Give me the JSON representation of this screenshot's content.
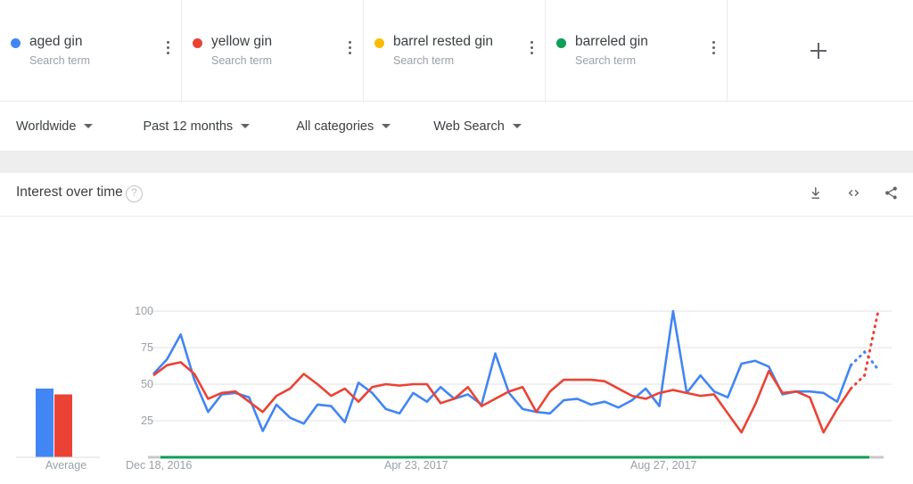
{
  "terms": [
    {
      "label": "aged gin",
      "sub": "Search term",
      "color": "#4285F4",
      "menu_icon": "kebab-menu-icon"
    },
    {
      "label": "yellow gin",
      "sub": "Search term",
      "color": "#EA4335",
      "menu_icon": "kebab-menu-icon"
    },
    {
      "label": "barrel rested gin",
      "sub": "Search term",
      "color": "#FBBC04",
      "menu_icon": "kebab-menu-icon"
    },
    {
      "label": "barreled gin",
      "sub": "Search term",
      "color": "#0F9D58",
      "menu_icon": "kebab-menu-icon"
    }
  ],
  "add_button": {
    "label": "+",
    "icon": "plus-icon"
  },
  "filters": [
    {
      "label": "Worldwide",
      "icon": "chevron-down-icon"
    },
    {
      "label": "Past 12 months",
      "icon": "chevron-down-icon"
    },
    {
      "label": "All categories",
      "icon": "chevron-down-icon"
    },
    {
      "label": "Web Search",
      "icon": "chevron-down-icon"
    }
  ],
  "chart_card": {
    "title": "Interest over time",
    "help_glyph": "?",
    "actions": [
      {
        "name": "download-icon",
        "tooltip": "Download"
      },
      {
        "name": "embed-code-icon",
        "tooltip": "Embed"
      },
      {
        "name": "share-icon",
        "tooltip": "Share"
      }
    ],
    "average_label": "Average"
  },
  "chart_data": {
    "type": "line",
    "title": "Interest over time",
    "xlabel": "",
    "ylabel": "",
    "ylim": [
      0,
      100
    ],
    "grid": true,
    "legend": "top-cards",
    "x_tick_labels": [
      "Dec 18, 2016",
      "Apr 23, 2017",
      "Aug 27, 2017"
    ],
    "x_tick_positions": [
      0,
      18,
      36
    ],
    "y_ticks": [
      25,
      50,
      75,
      100
    ],
    "n_points": 53,
    "partial_tail_points": 2,
    "series": [
      {
        "name": "aged gin",
        "color": "#4285F4",
        "values": [
          57,
          67,
          84,
          53,
          31,
          43,
          44,
          41,
          18,
          36,
          27,
          23,
          36,
          35,
          24,
          51,
          44,
          33,
          30,
          44,
          38,
          48,
          40,
          43,
          36,
          71,
          44,
          33,
          31,
          30,
          39,
          40,
          36,
          38,
          34,
          39,
          47,
          35,
          100,
          44,
          56,
          45,
          41,
          64,
          66,
          62,
          43,
          45,
          45,
          44,
          38,
          63,
          72,
          60
        ],
        "average": 47
      },
      {
        "name": "yellow gin",
        "color": "#EA4335",
        "values": [
          56,
          63,
          65,
          57,
          40,
          44,
          45,
          38,
          31,
          42,
          47,
          57,
          50,
          42,
          47,
          38,
          48,
          50,
          49,
          50,
          50,
          37,
          40,
          48,
          35,
          40,
          45,
          48,
          31,
          45,
          53,
          53,
          53,
          52,
          47,
          42,
          40,
          44,
          46,
          44,
          42,
          43,
          30,
          17,
          36,
          59,
          44,
          45,
          41,
          17,
          33,
          47,
          56,
          100
        ],
        "average": 43
      },
      {
        "name": "barrel rested gin",
        "color": "#FBBC04",
        "values": [
          0,
          0,
          0,
          0,
          0,
          0,
          0,
          0,
          0,
          0,
          0,
          0,
          0,
          0,
          0,
          0,
          0,
          0,
          0,
          0,
          0,
          0,
          0,
          0,
          0,
          0,
          0,
          0,
          0,
          0,
          0,
          0,
          0,
          0,
          0,
          0,
          0,
          0,
          0,
          0,
          0,
          0,
          0,
          0,
          0,
          0,
          0,
          0,
          0,
          0,
          0,
          0,
          0,
          0
        ],
        "average": 0
      },
      {
        "name": "barreled gin",
        "color": "#0F9D58",
        "values": [
          0,
          0,
          0,
          0,
          0,
          0,
          0,
          0,
          0,
          0,
          0,
          0,
          0,
          0,
          0,
          0,
          0,
          0,
          0,
          0,
          0,
          0,
          0,
          0,
          0,
          0,
          0,
          0,
          0,
          0,
          0,
          0,
          0,
          0,
          0,
          0,
          0,
          0,
          0,
          0,
          0,
          0,
          0,
          0,
          0,
          0,
          0,
          0,
          0,
          0,
          0,
          0,
          0,
          0
        ],
        "average": 0
      }
    ],
    "average_bars": {
      "label": "Average",
      "values": [
        47,
        43,
        0,
        0
      ],
      "colors": [
        "#4285F4",
        "#EA4335",
        "#FBBC04",
        "#0F9D58"
      ]
    }
  }
}
